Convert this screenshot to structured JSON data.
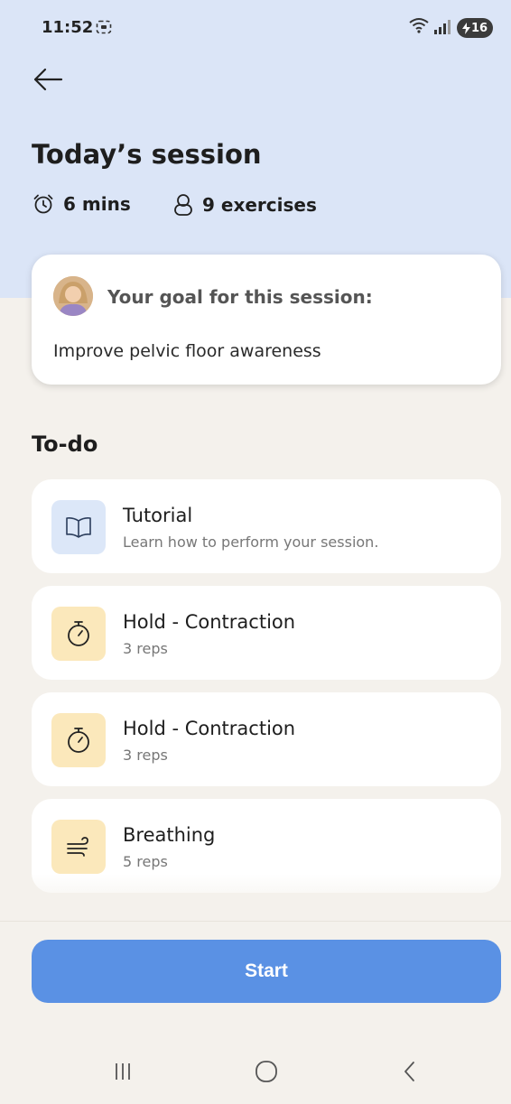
{
  "status_bar": {
    "time": "11:52",
    "battery": "16"
  },
  "header": {
    "title": "Today’s session",
    "duration": "6 mins",
    "exercises": "9 exercises"
  },
  "goal": {
    "label": "Your goal for this session:",
    "text": "Improve pelvic floor awareness"
  },
  "todo": {
    "heading": "To-do",
    "items": [
      {
        "name": "Tutorial",
        "sub": "Learn how to perform your session.",
        "icon": "book-icon",
        "icon_bg": "#dce7f8"
      },
      {
        "name": "Hold - Contraction",
        "sub": "3 reps",
        "icon": "stopwatch-icon",
        "icon_bg": "#fbe8bb"
      },
      {
        "name": "Hold - Contraction",
        "sub": "3 reps",
        "icon": "stopwatch-icon",
        "icon_bg": "#fbe8bb"
      },
      {
        "name": "Breathing",
        "sub": "5 reps",
        "icon": "wind-icon",
        "icon_bg": "#fbe8bb"
      }
    ]
  },
  "start_button": {
    "label": "Start",
    "color": "#5a91e4"
  },
  "colors": {
    "header_bg": "#dbe5f7",
    "page_bg": "#f4f1ec"
  }
}
